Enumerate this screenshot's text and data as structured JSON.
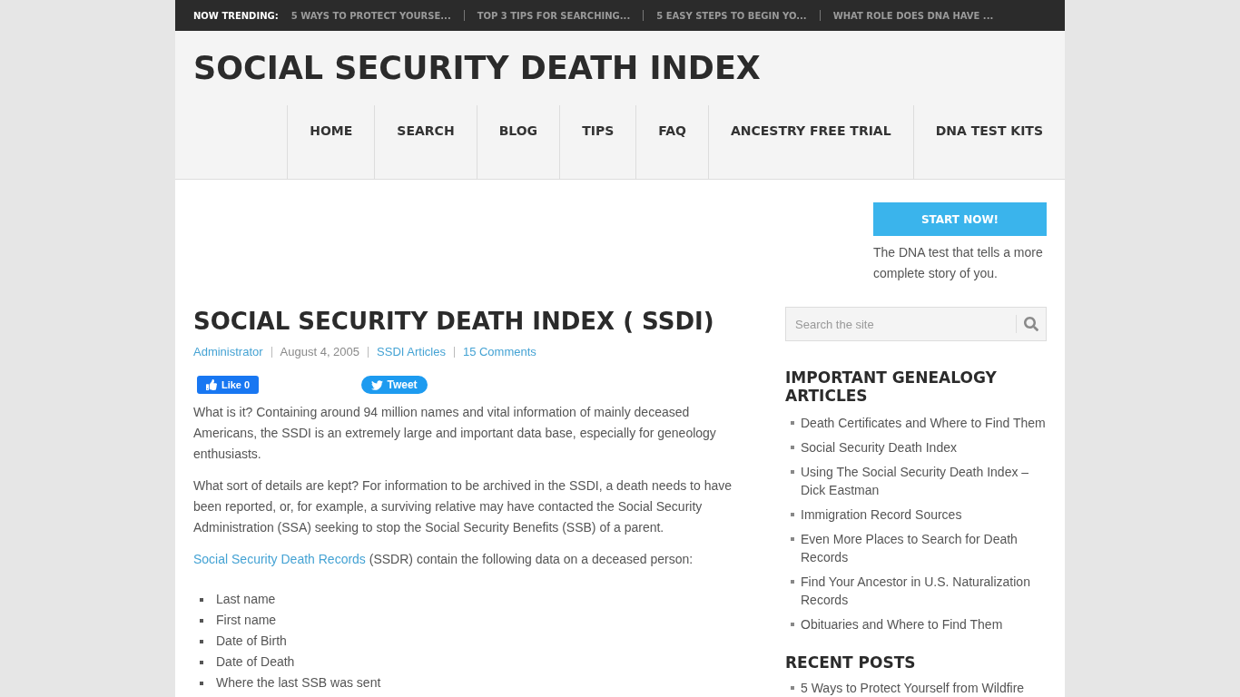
{
  "trending": {
    "label": "NOW TRENDING:",
    "items": [
      "5 WAYS TO PROTECT YOURSE...",
      "TOP 3 TIPS FOR SEARCHING...",
      "5 EASY STEPS TO BEGIN YO...",
      "WHAT ROLE DOES DNA HAVE ..."
    ]
  },
  "header": {
    "site_title": "SOCIAL SECURITY DEATH INDEX",
    "nav": [
      "HOME",
      "SEARCH",
      "BLOG",
      "TIPS",
      "FAQ",
      "ANCESTRY FREE TRIAL",
      "DNA TEST KITS"
    ]
  },
  "promo": {
    "button": "START NOW!",
    "text": "The DNA test that tells a more complete story of you."
  },
  "article": {
    "title": "SOCIAL SECURITY DEATH INDEX ( SSDI)",
    "meta": [
      {
        "kind": "author",
        "text": "Administrator"
      },
      {
        "kind": "date",
        "text": "August 4, 2005"
      },
      {
        "kind": "category",
        "text": "SSDI Articles"
      },
      {
        "kind": "comments",
        "text": "15 Comments"
      }
    ],
    "like_button": "Like 0",
    "tweet_button": "Tweet",
    "paragraphs": [
      "What is it? Containing around 94 million names and vital information of mainly deceased Americans, the SSDI is an extremely large and important data base, especially for geneology enthusiasts.",
      "What sort of details are kept? For information to be archived in the SSDI, a death needs to have been reported, or, for example, a surviving relative may have contacted the Social Security Administration (SSA) seeking to stop the Social Security Benefits (SSB) of a parent."
    ],
    "records_sentence": {
      "link": "Social Security Death Records",
      "text": "(SSDR) contain the following data on a deceased person:"
    },
    "fields": [
      "Last name",
      "First name",
      "Date of Birth",
      "Date of Death",
      "Where the last SSB was sent"
    ]
  },
  "sidebar": {
    "search": {
      "placeholder": "Search the site"
    },
    "widgets": [
      {
        "title": "IMPORTANT GENEALOGY ARTICLES",
        "items": [
          "Death Certificates and Where to Find Them",
          "Social Security Death Index",
          "Using The Social Security Death Index – Dick Eastman",
          "Immigration Record Sources",
          "Even More Places to Search for Death Records",
          "Find Your Ancestor in U.S. Naturalization Records",
          "Obituaries and Where to Find Them"
        ]
      },
      {
        "title": "RECENT POSTS",
        "items": [
          "5 Ways to Protect Yourself from Wildfire"
        ]
      }
    ]
  }
}
